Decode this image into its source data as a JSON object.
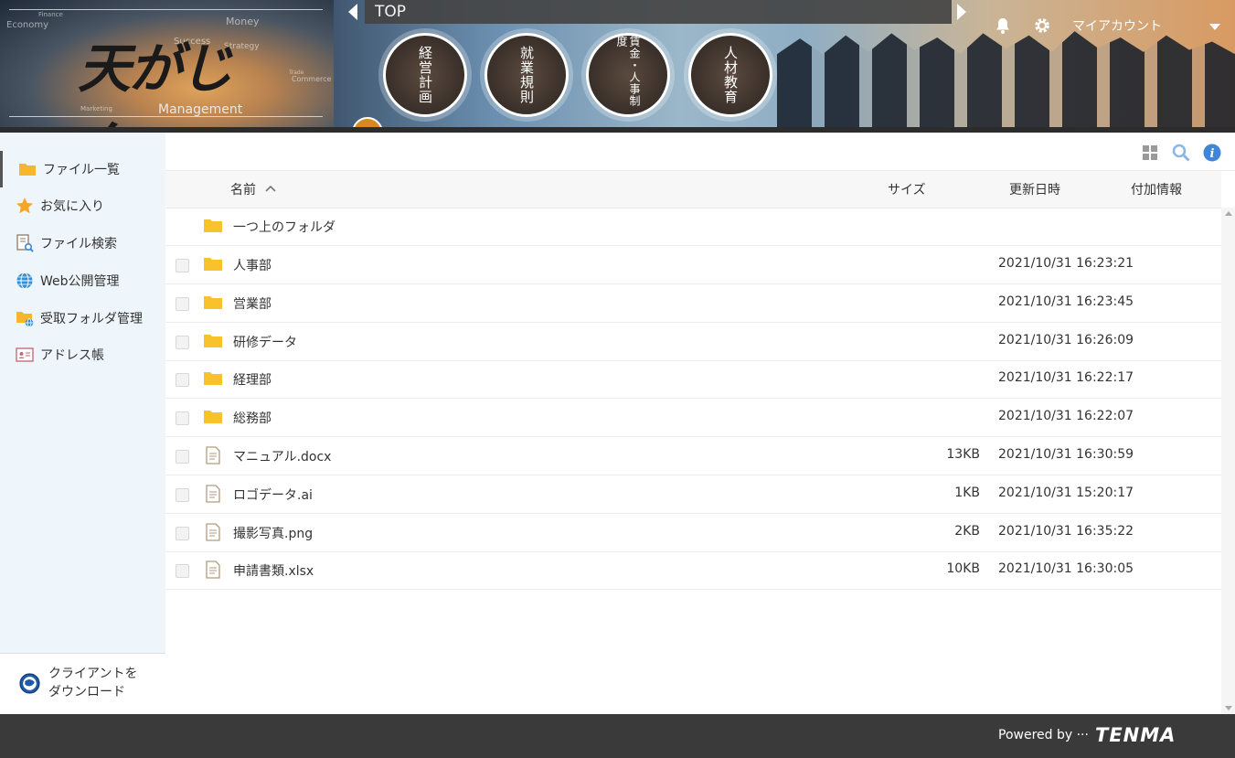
{
  "header": {
    "logo_text": "天がじん",
    "logo_sub": "Management",
    "bg_words": [
      "Economy",
      "Finance",
      "Money",
      "Success",
      "Strategy",
      "Trade",
      "Commerce",
      "Marketing"
    ],
    "nav_title": "TOP",
    "circles": [
      "経営計画",
      "就業規則",
      "賃金・人事制度",
      "人材教育"
    ],
    "account_label": "マイアカウント"
  },
  "sidebar": {
    "items": [
      {
        "label": "ファイル一覧",
        "icon": "folder-icon"
      },
      {
        "label": "お気に入り",
        "icon": "star-icon"
      },
      {
        "label": "ファイル検索",
        "icon": "file-search-icon"
      },
      {
        "label": "Web公開管理",
        "icon": "globe-icon"
      },
      {
        "label": "受取フォルダ管理",
        "icon": "receive-folder-icon"
      },
      {
        "label": "アドレス帳",
        "icon": "address-book-icon"
      }
    ],
    "client_download": {
      "line1": "クライアントを",
      "line2": "ダウンロード"
    }
  },
  "table": {
    "columns": {
      "name": "名前",
      "size": "サイズ",
      "updated": "更新日時",
      "info": "付加情報"
    },
    "parent_folder": "一つ上のフォルダ",
    "rows": [
      {
        "type": "folder",
        "name": "人事部",
        "size": "",
        "updated": "2021/10/31 16:23:21"
      },
      {
        "type": "folder",
        "name": "営業部",
        "size": "",
        "updated": "2021/10/31 16:23:45"
      },
      {
        "type": "folder",
        "name": "研修データ",
        "size": "",
        "updated": "2021/10/31 16:26:09"
      },
      {
        "type": "folder",
        "name": "経理部",
        "size": "",
        "updated": "2021/10/31 16:22:17"
      },
      {
        "type": "folder",
        "name": "総務部",
        "size": "",
        "updated": "2021/10/31 16:22:07"
      },
      {
        "type": "file",
        "name": "マニュアル.docx",
        "size": "13KB",
        "updated": "2021/10/31 16:30:59"
      },
      {
        "type": "file",
        "name": "ロゴデータ.ai",
        "size": "1KB",
        "updated": "2021/10/31 15:20:17"
      },
      {
        "type": "file",
        "name": "撮影写真.png",
        "size": "2KB",
        "updated": "2021/10/31 16:35:22"
      },
      {
        "type": "file",
        "name": "申請書類.xlsx",
        "size": "10KB",
        "updated": "2021/10/31 16:30:05"
      }
    ]
  },
  "footer": {
    "powered": "Powered by ···",
    "brand": "TENMA"
  },
  "colors": {
    "folder": "#f8c22c",
    "accent": "#3f86d6",
    "sidebar_bg": "#eef6fb",
    "footer_bg": "#3a3a3a"
  }
}
